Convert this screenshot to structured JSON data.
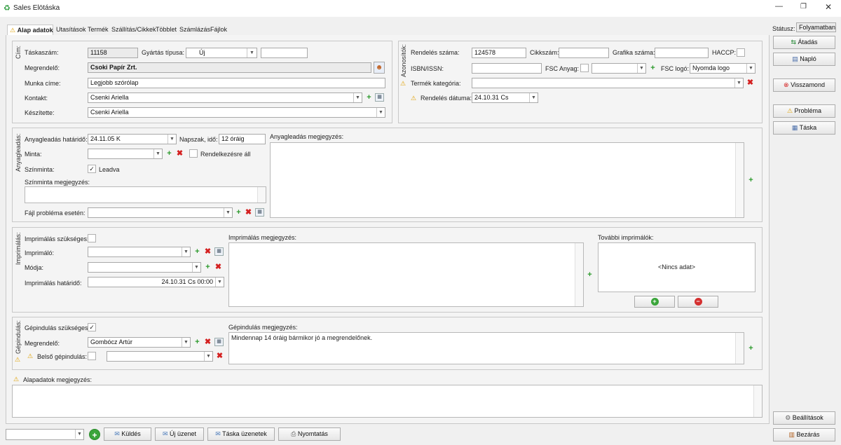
{
  "window": {
    "title": "Sales Elötáska"
  },
  "tabs": [
    "Alap adatok",
    "Utasítások",
    "Termék",
    "Szállítás/Cikkek",
    "Többlet",
    "Számlázás",
    "Fájlok"
  ],
  "status": {
    "label": "Státusz:",
    "value": "Folyamatban"
  },
  "side_buttons": {
    "atadas": "Átadás",
    "naplo": "Napló",
    "visszamond": "Visszamond",
    "problema": "Probléma",
    "taska": "Táska",
    "beallitasok": "Beállítások",
    "bezaras": "Bezárás"
  },
  "cim": {
    "group_label": "Cím:",
    "taskaszam_label": "Táskaszám:",
    "taskaszam": "11158",
    "gyartas_tipusa_label": "Gyártás típusa:",
    "gyartas_tipusa": "Új",
    "megrendelo_label": "Megrendelő:",
    "megrendelo": "Csoki Papír Zrt.",
    "munka_cime_label": "Munka címe:",
    "munka_cime": "Legjobb szórólap",
    "kontakt_label": "Kontakt:",
    "kontakt": "Csenki Ariella",
    "keszitette_label": "Készítette:",
    "keszitette": "Csenki Ariella"
  },
  "azonositok": {
    "group_label": "Azonosítók:",
    "rendeles_szama_label": "Rendelés száma:",
    "rendeles_szama": "124578",
    "cikkszam_label": "Cikkszám:",
    "grafika_szama_label": "Grafika száma:",
    "haccp_label": "HACCP:",
    "isbn_label": "ISBN/ISSN:",
    "fsc_anyag_label": "FSC Anyag:",
    "fsc_logo_label": "FSC logó:",
    "fsc_logo": "Nyomda logo",
    "termek_kategoria_label": "Termék kategória:",
    "rendeles_datuma_label": "Rendelés dátuma:",
    "rendeles_datuma": "24.10.31 Cs"
  },
  "anyagleadas": {
    "group_label": "Anyagleadás:",
    "hatarido_label": "Anyagleadás határidő:",
    "hatarido": "24.11.05 K",
    "napszak_label": "Napszak, idő:",
    "napszak": "12 óráig",
    "minta_label": "Minta:",
    "rendelkezesre_label": "Rendelkezésre áll",
    "szinminta_label": "Színminta:",
    "leadva_label": "Leadva",
    "leadva_checked": true,
    "szinminta_megj_label": "Színminta megjegyzés:",
    "fajl_problema_label": "Fájl probléma esetén:",
    "megjegyzes_label": "Anyagleadás megjegyzés:"
  },
  "imprimalas": {
    "group_label": "Imprimálás:",
    "szukseges_label": "Imprimálás szükséges:",
    "imprimalo_label": "Imprimáló:",
    "modja_label": "Módja:",
    "hatarido_label": "Imprimálás határidő:",
    "hatarido": "24.10.31 Cs 00:00",
    "megjegyzes_label": "Imprimálás megjegyzés:",
    "tovabbi_label": "További imprimálók:",
    "nincs_adat": "<Nincs adat>"
  },
  "gepindulas": {
    "group_label": "Gépindulás:",
    "szukseges_label": "Gépindulás szükséges:",
    "szukseges_checked": true,
    "megrendelo_label": "Megrendelő:",
    "megrendelo": "Gombócz Artúr",
    "belso_label": "Belső gépindulás:",
    "megjegyzes_label": "Gépindulás megjegyzés:",
    "megjegyzes": "Mindennap 14 óráig bármikor jó a megrendelőnek."
  },
  "alapadatok_megj_label": "Alapadatok megjegyzés:",
  "bottom": {
    "kuldes": "Küldés",
    "uj_uzenet": "Új üzenet",
    "taska_uzenetek": "Táska üzenetek",
    "nyomtatas": "Nyomtatás"
  }
}
